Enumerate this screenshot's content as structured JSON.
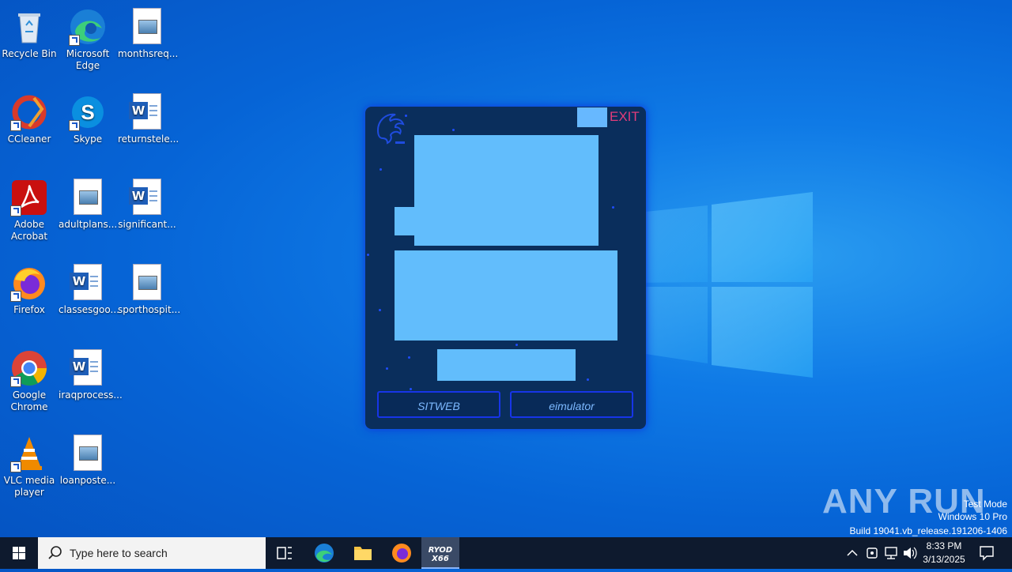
{
  "desktop": {
    "icons": [
      {
        "label": "Recycle Bin",
        "icon": "recycle-bin-icon"
      },
      {
        "label": "Microsoft Edge",
        "icon": "edge-icon"
      },
      {
        "label": "monthsreq...",
        "icon": "image-file-icon"
      },
      {
        "label": "CCleaner",
        "icon": "ccleaner-icon"
      },
      {
        "label": "Skype",
        "icon": "skype-icon"
      },
      {
        "label": "returnstele...",
        "icon": "word-doc-icon"
      },
      {
        "label": "Adobe Acrobat",
        "icon": "acrobat-icon"
      },
      {
        "label": "adultplans...",
        "icon": "image-file-icon"
      },
      {
        "label": "significant...",
        "icon": "word-doc-icon"
      },
      {
        "label": "Firefox",
        "icon": "firefox-icon"
      },
      {
        "label": "classesgoo...",
        "icon": "word-doc-icon"
      },
      {
        "label": "sporthospit...",
        "icon": "image-file-icon"
      },
      {
        "label": "Google Chrome",
        "icon": "chrome-icon"
      },
      {
        "label": "iraqprocess...",
        "icon": "word-doc-icon"
      },
      {
        "label": "VLC media player",
        "icon": "vlc-icon"
      },
      {
        "label": "loanposte...",
        "icon": "image-file-icon"
      }
    ]
  },
  "app": {
    "exit_label": "EXIT",
    "button_left": "SITWEB",
    "button_right": "eimulator",
    "logo_icon": "dragon-logo-icon"
  },
  "watermark": {
    "brand": "ANY RUN",
    "mode": "Test Mode",
    "edition": "Windows 10 Pro",
    "build": "Build 19041.vb_release.191206-1406"
  },
  "taskbar": {
    "search_placeholder": "Type here to search",
    "active_app": "RYOD X66",
    "time": "8:33 PM",
    "date": "3/13/2025"
  },
  "colors": {
    "app_bg": "#0a2e5c",
    "panel": "#62bdfc",
    "exit": "#e23c7a",
    "button_border": "#1735e8"
  }
}
